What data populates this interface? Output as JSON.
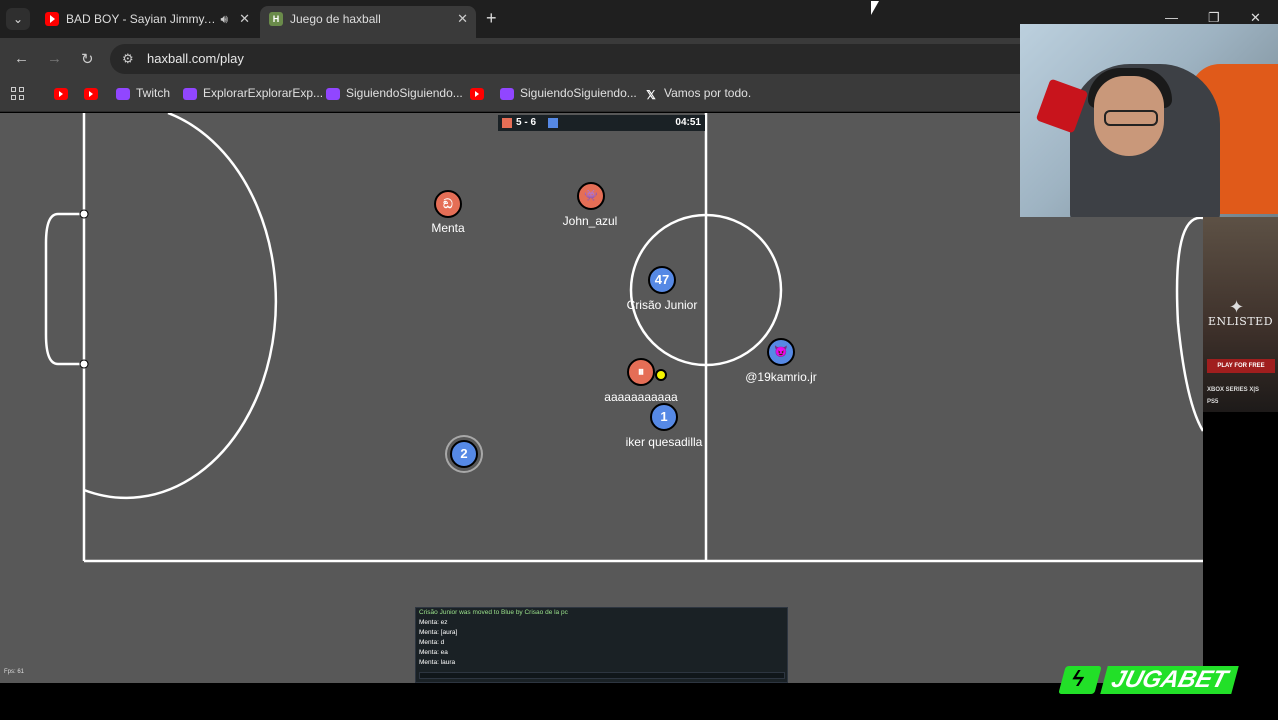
{
  "browser": {
    "tabs": [
      {
        "title": "BAD BOY - Sayian Jimmy, N",
        "favicon": "youtube-icon",
        "audio": true,
        "active": false
      },
      {
        "title": "Juego de haxball",
        "favicon": "haxball-icon",
        "active": true
      }
    ],
    "url": "haxball.com/play",
    "bookmarks": [
      {
        "label": "",
        "icon": "youtube-icon"
      },
      {
        "label": "",
        "icon": "youtube-icon"
      },
      {
        "label": "Twitch",
        "icon": "twitch-icon"
      },
      {
        "label": "ExplorarExplorarExp...",
        "icon": "twitch-icon"
      },
      {
        "label": "SiguiendoSiguiendo...",
        "icon": "twitch-icon"
      },
      {
        "label": "",
        "icon": "youtube-icon"
      },
      {
        "label": "SiguiendoSiguiendo...",
        "icon": "twitch-icon"
      },
      {
        "label": "Vamos por todo.",
        "icon": "x-icon"
      }
    ]
  },
  "game": {
    "score": "5 - 6",
    "time": "04:51",
    "team_colors": {
      "red": "#e56e56",
      "blue": "#5689e5"
    },
    "players": [
      {
        "name": "Menta",
        "team": "red",
        "avatar": "ඞ"
      },
      {
        "name": "John_azul",
        "team": "red",
        "avatar": "👾"
      },
      {
        "name": "Crisão Junior",
        "team": "blue",
        "avatar": "47"
      },
      {
        "name": "aaaaaaaaaaa",
        "team": "red",
        "avatar": "⏸"
      },
      {
        "name": "iker quesadilla",
        "team": "blue",
        "avatar": "1"
      },
      {
        "name": "@19kamrio.jr",
        "team": "blue",
        "avatar": "😈"
      },
      {
        "name": "",
        "team": "blue",
        "avatar": "2"
      }
    ],
    "chat": {
      "system": "Crisão Junior was moved to Blue by Crisao de la pc",
      "messages": [
        "Menta: ez",
        "Menta: [aura]",
        "Menta: d",
        "Menta: ea",
        "Menta: laura"
      ]
    },
    "fps": "Fps: 61"
  },
  "ad": {
    "brand": "ENLISTED",
    "cta": "PLAY FOR FREE",
    "platforms": [
      "XBOX SERIES X|S",
      "PS5"
    ]
  },
  "sponsor": {
    "left": "JUGA",
    "right": "BET"
  }
}
